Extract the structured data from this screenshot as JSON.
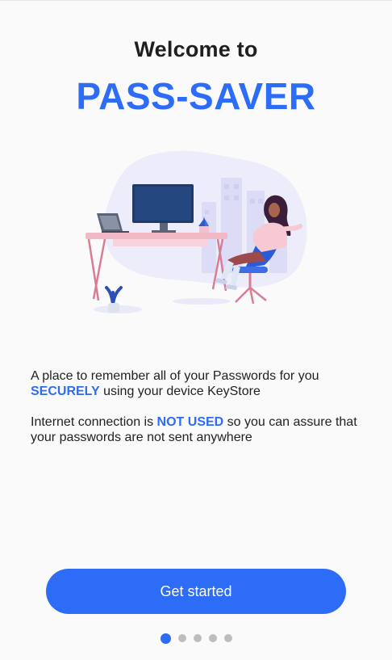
{
  "welcome": {
    "line1": "Welcome to",
    "app_name": "PASS-SAVER"
  },
  "description": {
    "p1_before": "A place to remember all of your Passwords for you",
    "p1_highlight": "SECURELY",
    "p1_after": " using your device KeyStore",
    "p2_before": "Internet connection is ",
    "p2_highlight": "NOT USED",
    "p2_after": " so you can assure that your passwords are not sent anywhere"
  },
  "cta": {
    "label": "Get started"
  },
  "pager": {
    "total": 5,
    "active_index": 0
  },
  "colors": {
    "accent": "#2d6cf6",
    "background": "#fafafa",
    "text": "#222222",
    "dot_inactive": "#bdbdbd"
  },
  "illustration": {
    "icon": "person-at-desk-illustration"
  }
}
